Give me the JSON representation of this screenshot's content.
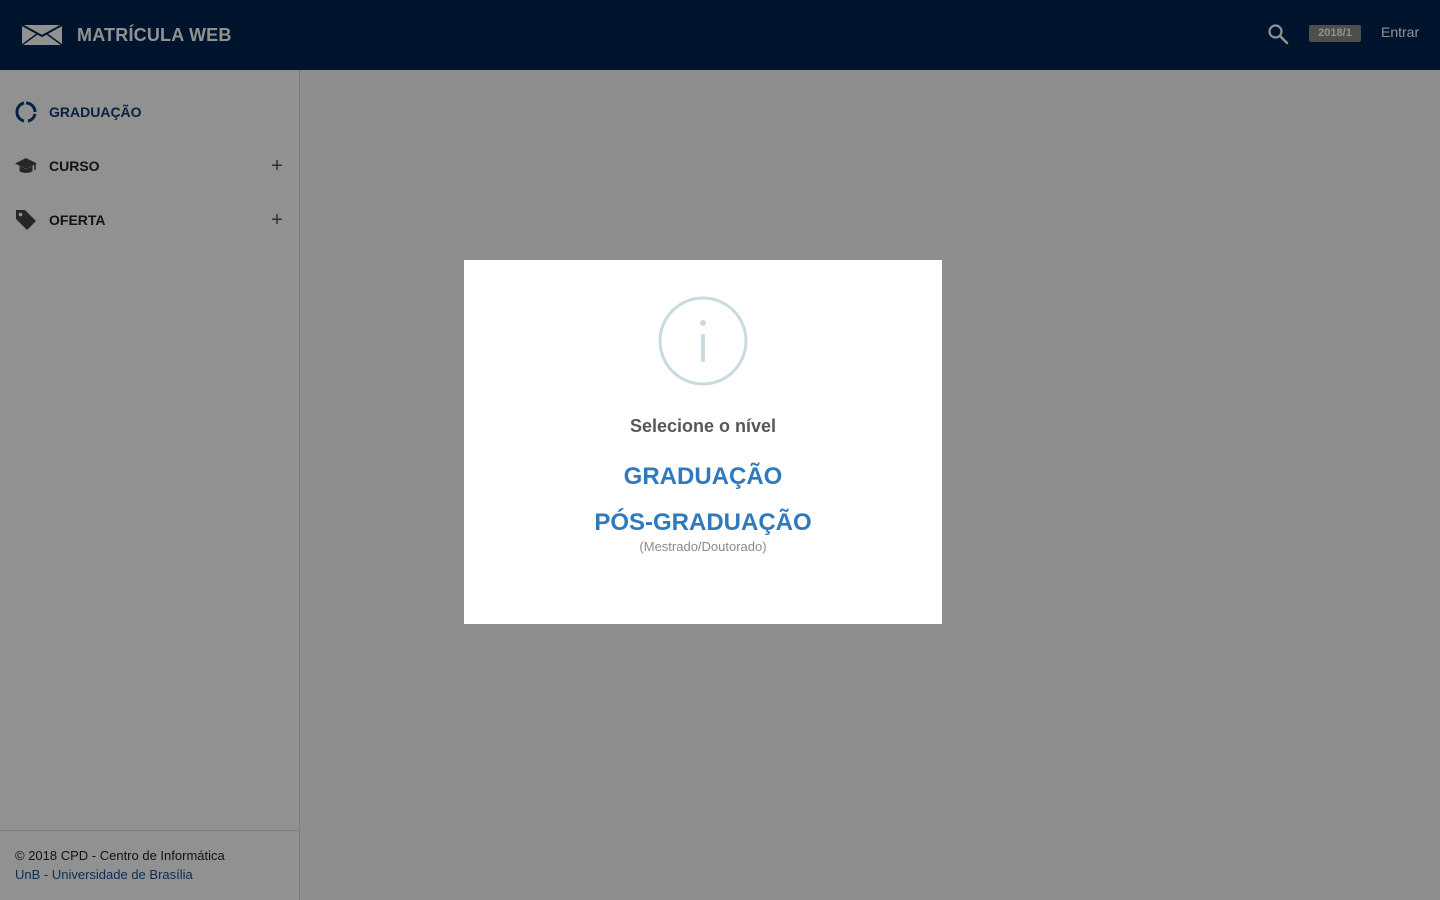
{
  "header": {
    "brand_icon": "envelope-logo-icon",
    "title": "MATRÍCULA WEB",
    "search_icon": "search-icon",
    "semester": "2018/1",
    "login": "Entrar"
  },
  "sidebar": {
    "items": [
      {
        "label": "GRADUAÇÃO",
        "icon": "circle-progress-icon",
        "active": true
      },
      {
        "label": "CURSO",
        "icon": "graduation-cap-icon",
        "expandable": true
      },
      {
        "label": "OFERTA",
        "icon": "tag-icon",
        "expandable": true
      }
    ],
    "footer": {
      "copyright": "© 2018 CPD - Centro de Informática",
      "link": "UnB - Universidade de Brasília"
    }
  },
  "modal": {
    "icon": "info-icon",
    "title": "Selecione o nível",
    "options": [
      {
        "label": "GRADUAÇÃO"
      },
      {
        "label": "PÓS-GRADUAÇÃO",
        "sublabel": "(Mestrado/Doutorado)"
      }
    ]
  },
  "colors": {
    "header_bg": "#00264f",
    "link_blue": "#2f7abf",
    "active_nav": "#0b3a72",
    "overlay": "rgba(0,0,0,0.43)"
  }
}
